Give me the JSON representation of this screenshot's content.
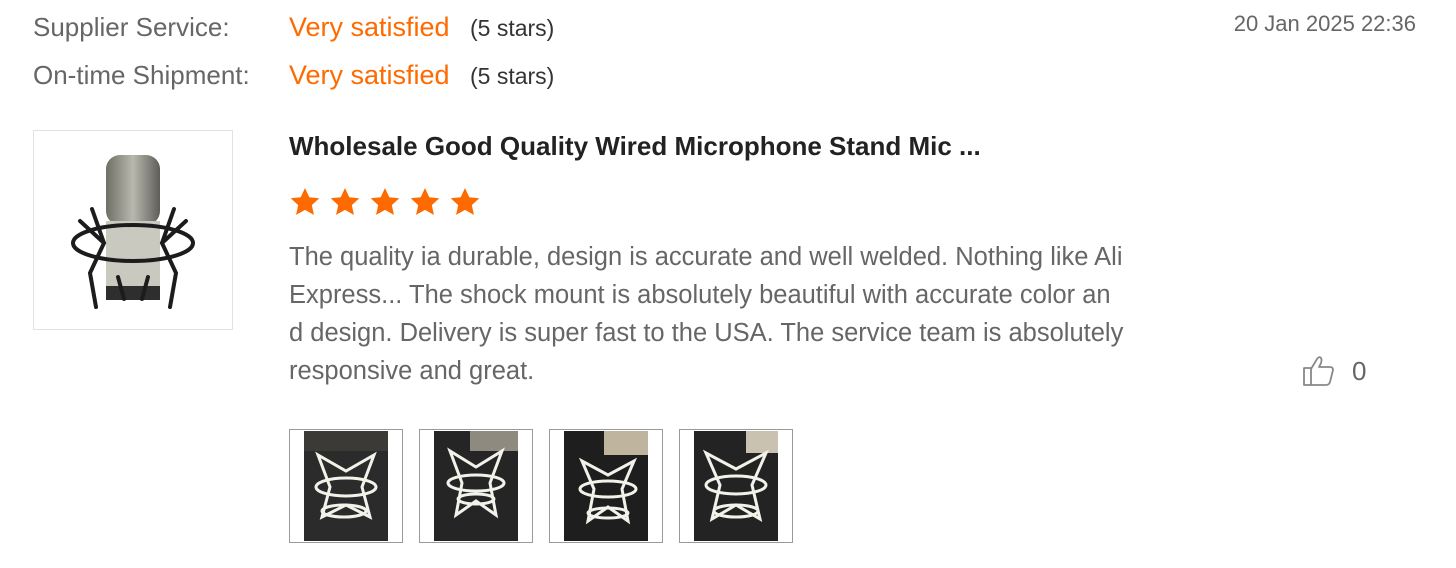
{
  "ratings": [
    {
      "label": "Supplier Service:",
      "value": "Very satisfied",
      "stars": "(5 stars)"
    },
    {
      "label": "On-time Shipment:",
      "value": "Very satisfied",
      "stars": "(5 stars)"
    }
  ],
  "review_date": "20 Jan 2025 22:36",
  "product": {
    "title": "Wholesale Good Quality Wired Microphone Stand Mic ...",
    "image_icon": "microphone-with-shock-mount"
  },
  "review": {
    "rating": 5,
    "lines": [
      "The quality ia durable, design is accurate and well welded. Nothing like Ali",
      "Express... The shock mount is absolutely beautiful with accurate color an",
      "d design. Delivery is super fast to the USA. The service team is absolutely",
      "responsive and great."
    ],
    "photos_count": 4
  },
  "like": {
    "icon": "thumbs-up-icon",
    "count": "0"
  },
  "colors": {
    "accent": "#ff6a00",
    "star": "#ff6a00",
    "text_muted": "#666666",
    "title": "#222222"
  }
}
